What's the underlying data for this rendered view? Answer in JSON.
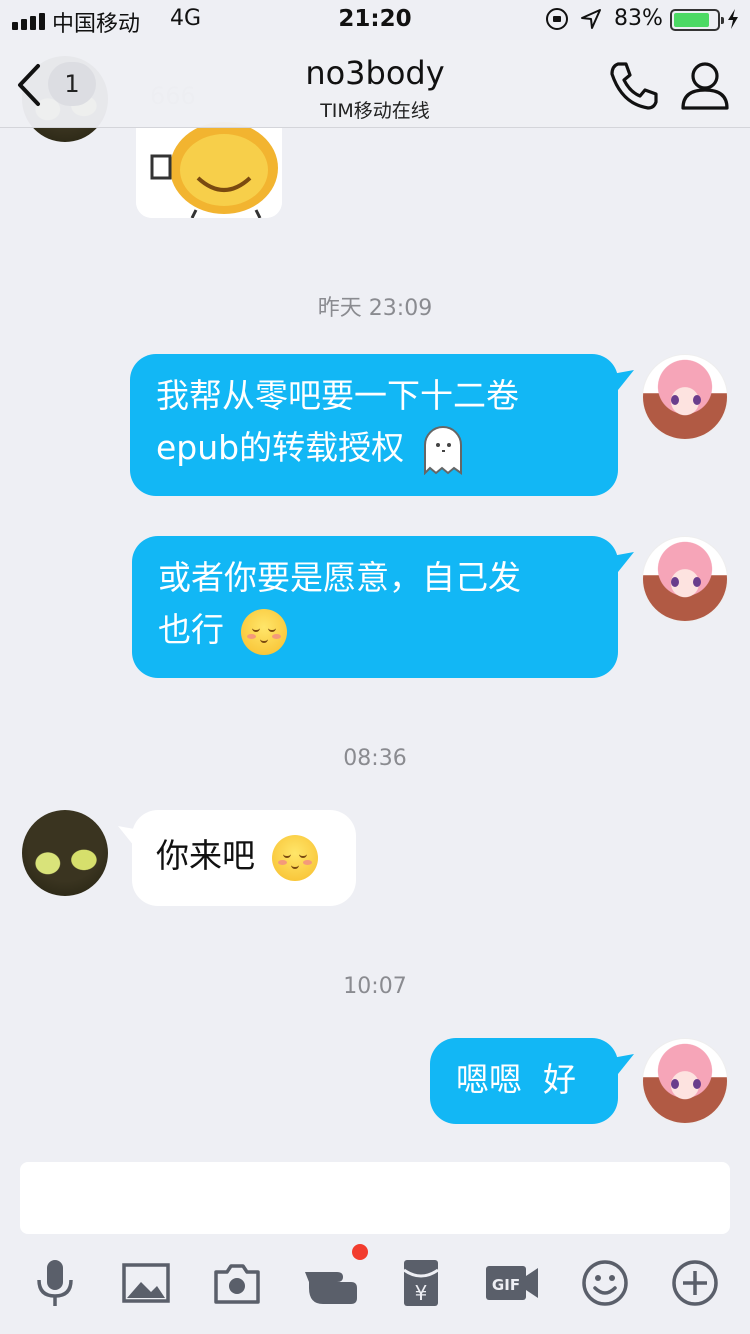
{
  "status_bar": {
    "carrier": "中国移动",
    "network": "4G",
    "time": "21:20",
    "battery_percent": "83%",
    "battery_level": 0.83,
    "battery_color": "#4cd964"
  },
  "nav": {
    "unread_count": "1",
    "contact_name": "no3body",
    "contact_status": "TIM移动在线",
    "icons": [
      "back-icon",
      "phone-icon",
      "profile-icon"
    ]
  },
  "messages": {
    "timestamps": [
      "昨天 23:09",
      "08:36",
      "10:07"
    ],
    "me_1_line1": "我帮从零吧要一下十二卷",
    "me_1_line2": "epub的转载授权",
    "me_2_line1": "或者你要是愿意，自己发",
    "me_2_line2": "也行",
    "them_1": "你来吧",
    "me_3": "嗯嗯  好",
    "bubble_color": "#12b7f5"
  },
  "input": {
    "placeholder": ""
  },
  "toolbar": {
    "icons": [
      "microphone-icon",
      "image-icon",
      "camera-icon",
      "poke-icon",
      "red-packet-icon",
      "gif-icon",
      "emoji-icon",
      "plus-icon"
    ],
    "notification_color": "#f23c2e"
  }
}
